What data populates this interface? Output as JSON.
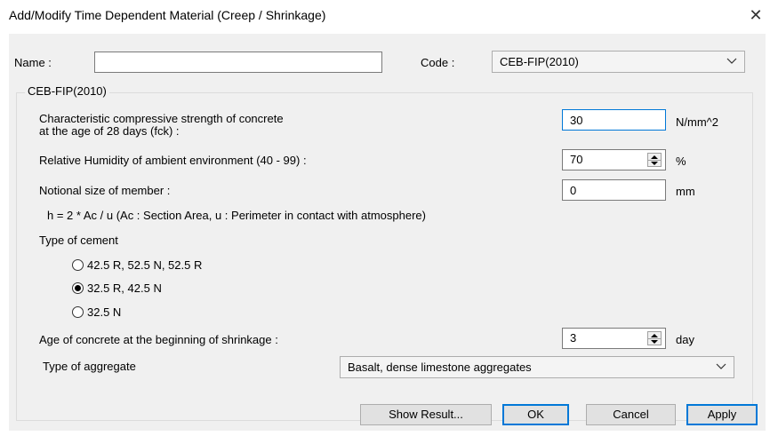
{
  "window": {
    "title": "Add/Modify Time Dependent Material (Creep / Shrinkage)",
    "close_glyph": "✕"
  },
  "name_field": {
    "label": "Name :",
    "value": ""
  },
  "code_field": {
    "label": "Code :",
    "value": "CEB-FIP(2010)"
  },
  "group": {
    "title": "CEB-FIP(2010)",
    "fck_label_line1": "Characteristic compressive strength of concrete",
    "fck_label_line2": "at the age of 28 days (fck) :",
    "fck_value": "30",
    "fck_unit": "N/mm^2",
    "rh_label": "Relative Humidity of ambient environment (40 - 99) :",
    "rh_value": "70",
    "rh_unit": "%",
    "notional_label": "Notional size of member :",
    "notional_value": "0",
    "notional_unit": "mm",
    "formula_text": "h = 2 * Ac / u  (Ac : Section Area, u : Perimeter in contact with atmosphere)",
    "cement_label": "Type of cement",
    "cement_options": [
      {
        "label": "42.5 R, 52.5 N, 52.5 R",
        "selected": false
      },
      {
        "label": "32.5 R, 42.5 N",
        "selected": true
      },
      {
        "label": "32.5 N",
        "selected": false
      }
    ],
    "age_label": "Age of concrete at the beginning of shrinkage :",
    "age_value": "3",
    "age_unit": "day",
    "aggregate_label": "Type of aggregate",
    "aggregate_value": "Basalt, dense limestone aggregates"
  },
  "buttons": {
    "show_result": "Show Result...",
    "ok": "OK",
    "cancel": "Cancel",
    "apply": "Apply"
  },
  "colors": {
    "focus_accent": "#0078d7",
    "dialog_bg": "#f0f0f0"
  }
}
